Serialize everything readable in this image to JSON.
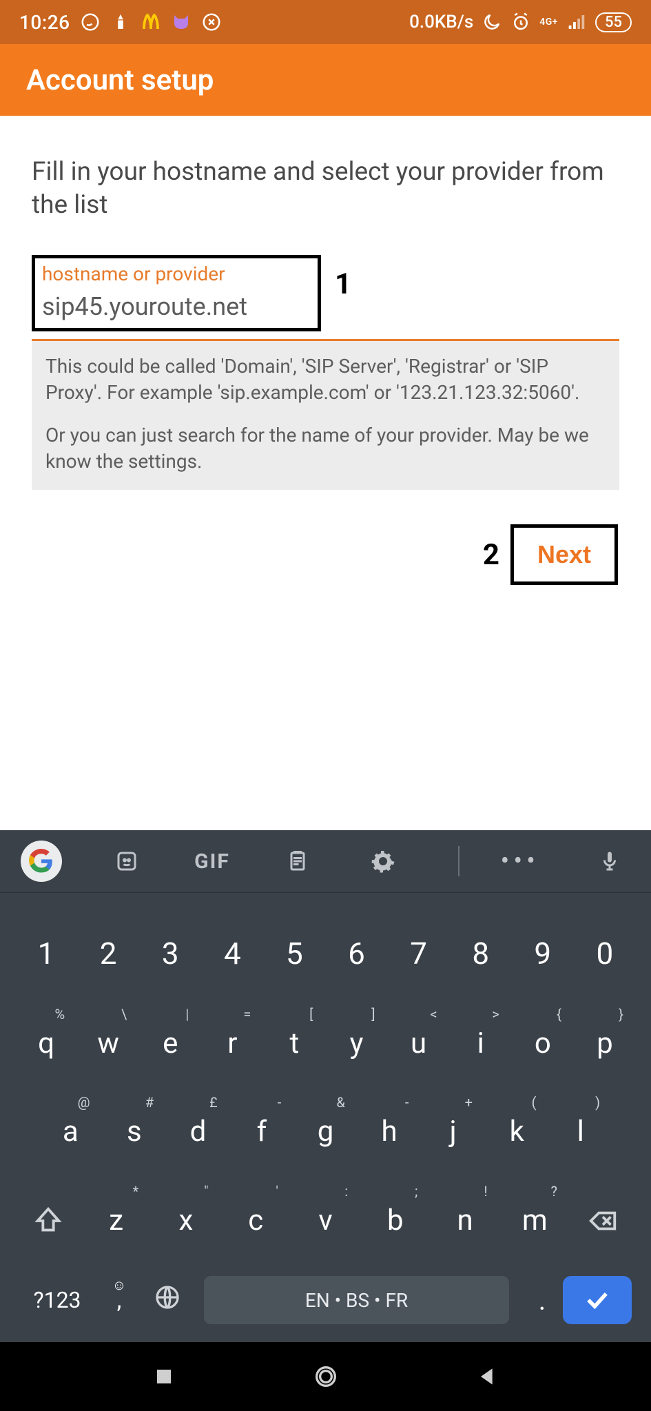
{
  "status": {
    "time": "10:26",
    "data_rate": "0.0KB/s",
    "network_label": "4G+",
    "battery": "55"
  },
  "app_bar": {
    "title": "Account setup"
  },
  "instructions": "Fill in your hostname and select your provider from the list",
  "field": {
    "label": "hostname or provider",
    "value": "sip45.youroute.net"
  },
  "help": {
    "p1": "This could be called 'Domain', 'SIP Server', 'Registrar' or 'SIP Proxy'. For example 'sip.example.com' or '123.21.123.32:5060'.",
    "p2": "Or you can just search for the name of your provider. May be we know the settings."
  },
  "annotations": {
    "one": "1",
    "two": "2"
  },
  "buttons": {
    "next": "Next"
  },
  "keyboard": {
    "gif": "GIF",
    "row_num": [
      "1",
      "2",
      "3",
      "4",
      "5",
      "6",
      "7",
      "8",
      "9",
      "0"
    ],
    "row_q": [
      [
        "q",
        "%"
      ],
      [
        "w",
        "\\"
      ],
      [
        "e",
        "|"
      ],
      [
        "r",
        "="
      ],
      [
        "t",
        "["
      ],
      [
        "y",
        "]"
      ],
      [
        "u",
        "<"
      ],
      [
        "i",
        ">"
      ],
      [
        "o",
        "{"
      ],
      [
        "p",
        "}"
      ]
    ],
    "row_a": [
      [
        "a",
        "@"
      ],
      [
        "s",
        "#"
      ],
      [
        "d",
        "£"
      ],
      [
        "f",
        "-"
      ],
      [
        "g",
        "&"
      ],
      [
        "h",
        "-"
      ],
      [
        "j",
        "+"
      ],
      [
        "k",
        "("
      ],
      [
        "l",
        ")"
      ]
    ],
    "row_z": [
      [
        "z",
        "*"
      ],
      [
        "x",
        "\""
      ],
      [
        "c",
        "'"
      ],
      [
        "v",
        ":"
      ],
      [
        "b",
        ";"
      ],
      [
        "n",
        "!"
      ],
      [
        "m",
        "?"
      ]
    ],
    "fn": "?123",
    "space": "EN • BS • FR",
    "period": "."
  }
}
